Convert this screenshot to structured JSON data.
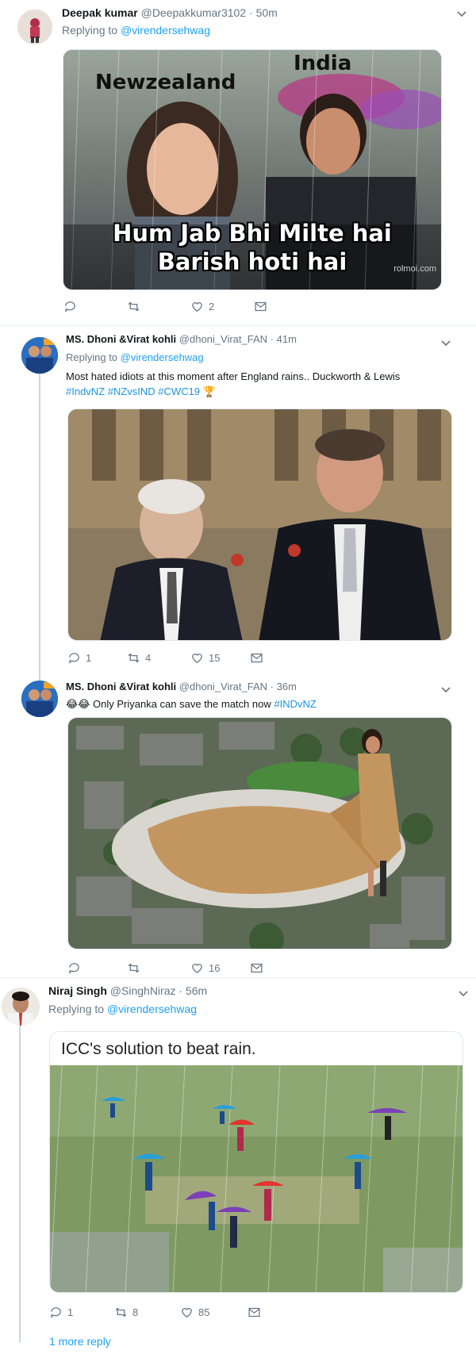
{
  "colors": {
    "link": "#1da1f2",
    "muted": "#657786",
    "text": "#14171a",
    "border": "#e6ecf0"
  },
  "tweets": [
    {
      "name": "Deepak kumar",
      "handle": "@Deepakkumar3102",
      "time": "· 50m",
      "replying_prefix": "Replying to",
      "replying_to": "@virendersehwag",
      "media_caption": {
        "top_left": "Newzealand",
        "top_right": "India",
        "line1": "Hum Jab Bhi Milte hai",
        "line2": "Barish hoti hai",
        "watermark": "rolmoi.com"
      },
      "replies": "",
      "retweets": "",
      "likes": "2"
    },
    {
      "name": "MS. Dhoni &Virat kohli",
      "handle": "@dhoni_Virat_FAN",
      "time": "· 41m",
      "replying_prefix": "Replying to",
      "replying_to": "@virendersehwag",
      "text": "Most hated idiots at this moment after England rains.. Duckworth & Lewis",
      "hashtags": "#IndvNZ #NZvsIND #CWC19 🏆",
      "replies": "1",
      "retweets": "4",
      "likes": "15"
    },
    {
      "name": "MS. Dhoni &Virat kohli",
      "handle": "@dhoni_Virat_FAN",
      "time": "· 36m",
      "emoji": "😂😂",
      "text": "Only Priyanka can save the match now",
      "hashtag": "#INDvNZ",
      "replies": "",
      "retweets": "",
      "likes": "16"
    },
    {
      "name": "Niraj Singh",
      "handle": "@SinghNiraz",
      "time": "· 56m",
      "replying_prefix": "Replying to",
      "replying_to": "@virendersehwag",
      "media_title": "ICC's solution to beat rain.",
      "replies": "1",
      "retweets": "8",
      "likes": "85"
    }
  ],
  "more_replies": "1 more reply"
}
